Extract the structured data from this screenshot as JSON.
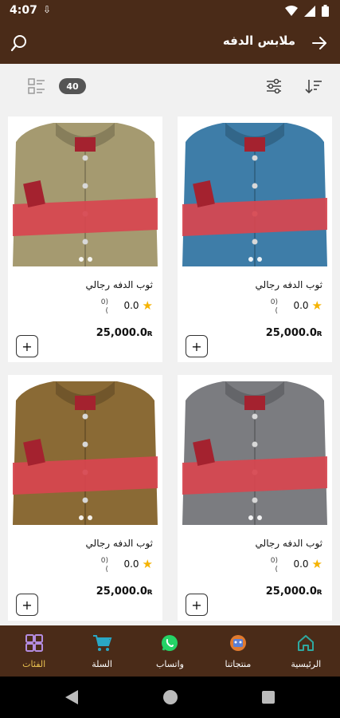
{
  "status_bar": {
    "time": "4:07"
  },
  "app_bar": {
    "title": "ملابس الدفه"
  },
  "toolbar": {
    "count": "40"
  },
  "products": [
    {
      "name": "ثوب الدفه رجالي",
      "rating": "0.0",
      "rating_count": "(0\n)",
      "price": "25,000.0",
      "currency_icon": "riyal-icon",
      "color": "#3e7da8"
    },
    {
      "name": "ثوب الدفه رجالي",
      "rating": "0.0",
      "rating_count": "(0\n)",
      "price": "25,000.0",
      "currency_icon": "riyal-icon",
      "color": "#a59a70"
    },
    {
      "name": "ثوب الدفه رجالي",
      "rating": "0.0",
      "rating_count": "(0\n)",
      "price": "25,000.0",
      "currency_icon": "riyal-icon",
      "color": "#7b7c80"
    },
    {
      "name": "ثوب الدفه رجالي",
      "rating": "0.0",
      "rating_count": "(0\n)",
      "price": "25,000.0",
      "currency_icon": "riyal-icon",
      "color": "#8a6a35"
    }
  ],
  "bottom_nav": [
    {
      "label": "الرئيسية",
      "icon": "home-icon",
      "color": "#2fa8a0"
    },
    {
      "label": "منتجاتنا",
      "icon": "products-icon",
      "color": "#e07a2f"
    },
    {
      "label": "واتساب",
      "icon": "whatsapp-icon",
      "color": "#25d366"
    },
    {
      "label": "السلة",
      "icon": "cart-icon",
      "color": "#2aa7c5"
    },
    {
      "label": "الفئات",
      "icon": "categories-icon",
      "color": "#b48ce0",
      "active": true
    }
  ],
  "colors": {
    "primary": "#4a2b18",
    "accent": "#e8c050",
    "star": "#f5b301"
  }
}
